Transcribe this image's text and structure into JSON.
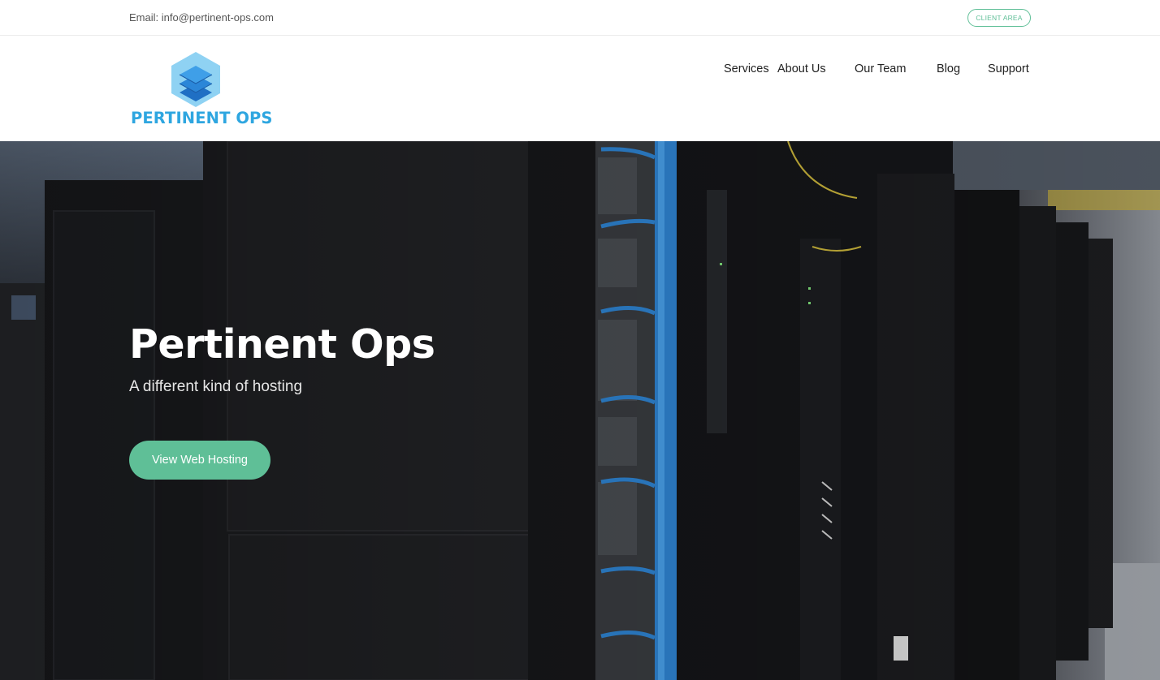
{
  "topbar": {
    "email": "Email: info@pertinent-ops.com",
    "client_area": "CLIENT AREA"
  },
  "brand": {
    "logo_text": "PERTINENT OPS",
    "logo_icon": "stacked-layers-hexagon-icon"
  },
  "nav": {
    "items": [
      "Services",
      "About Us",
      "Our Team",
      "Blog",
      "Support"
    ]
  },
  "hero": {
    "title": "Pertinent Ops",
    "subtitle": "A different kind of hosting",
    "cta": "View Web Hosting",
    "background": "server-racks-photo"
  },
  "colors": {
    "accent": "#5fbf97",
    "brand_blue": "#2ea6e0",
    "cable_blue": "#2f86d6"
  }
}
